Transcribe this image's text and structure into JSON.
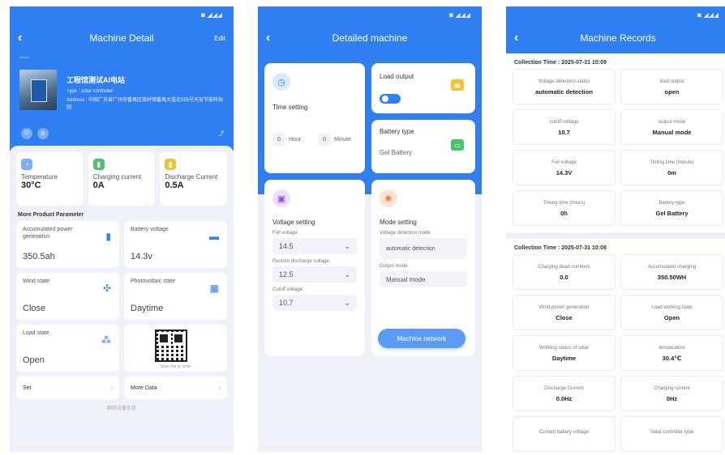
{
  "status_icons": "◾ ◢◢◢",
  "detail": {
    "nav": {
      "back": "‹",
      "title": "Machine Detail",
      "action": "Edit"
    },
    "badge": "",
    "number_label": "",
    "name": "工程馆测试AI电站",
    "type_line": "Type : solar controller",
    "address_line": "Address : 中国广东省广州市番禺区南村镇番禺大道北555号天安节能科技园",
    "share_icon": "share-icon",
    "stats": [
      {
        "label": "Temperature",
        "value": "30°C",
        "icon": "thermometer-icon",
        "color": "#7fb0f5",
        "glyph": "🌡"
      },
      {
        "label": "Charging current",
        "value": "0A",
        "icon": "battery-charge-icon",
        "color": "#4cc26a",
        "glyph": "▮"
      },
      {
        "label": "Discharge Current",
        "value": "0.5A",
        "icon": "battery-discharge-icon",
        "color": "#f5c02f",
        "glyph": "▮"
      }
    ],
    "section_title": "More Product Parameter",
    "params": [
      {
        "label": "Accumulated power generation",
        "value": "350.5ah",
        "icon": "battery-icon",
        "glyph": "▮"
      },
      {
        "label": "Battery voltage",
        "value": "14.3v",
        "icon": "voltage-icon",
        "glyph": "▬"
      },
      {
        "label": "Wind state",
        "value": "Close",
        "icon": "wind-icon",
        "glyph": "✣"
      },
      {
        "label": "Photovoltaic state",
        "value": "Daytime",
        "icon": "solar-panel-icon",
        "glyph": "▦"
      },
      {
        "label": "Load state",
        "value": "Open",
        "icon": "load-icon",
        "glyph": "⁂"
      }
    ],
    "qr_caption": "Scan the qr code",
    "selects": [
      {
        "value": "Set"
      },
      {
        "value": "More Data"
      }
    ],
    "footer": "解绑设备信息"
  },
  "machine": {
    "nav": {
      "back": "‹",
      "title": "Detailed machine"
    },
    "time": {
      "title": "Time setting",
      "hour": "Hour",
      "minute": "Minute",
      "hour_value": "0",
      "minute_value": "0"
    },
    "load": {
      "title": "Load output",
      "on": true
    },
    "battery": {
      "title": "Battery type",
      "value": "Gel Battery"
    },
    "voltage": {
      "title": "Voltage setting",
      "fields": [
        {
          "label": "Full voltage",
          "value": "14.5"
        },
        {
          "label": "Restore discharge voltage",
          "value": "12.5"
        },
        {
          "label": "Cutoff voltage",
          "value": "10.7"
        }
      ]
    },
    "mode": {
      "title": "Mode setting",
      "detect_label": "Voltage detection mode",
      "detect_value": "automatic detection",
      "output_label": "Output mode",
      "output_value": "Manual mode"
    },
    "button": "Machine network"
  },
  "records": {
    "nav": {
      "back": "‹",
      "title": "Machine Records"
    },
    "groups": [
      {
        "time": "Collection Time : 2025-07-31 10:09",
        "items": [
          {
            "label": "Voltage detection status",
            "value": "automatic detection"
          },
          {
            "label": "load output",
            "value": "open"
          },
          {
            "label": "cutoff voltage",
            "value": "10.7"
          },
          {
            "label": "output mode",
            "value": "Manual mode"
          },
          {
            "label": "Full voltage",
            "value": "14.3V"
          },
          {
            "label": "Timing time (minute)",
            "value": "0m"
          },
          {
            "label": "Timing time (hours)",
            "value": "0h"
          },
          {
            "label": "Battery type",
            "value": "Gel Battery"
          }
        ]
      },
      {
        "time": "Collection Time : 2025-07-31 10:08",
        "items": [
          {
            "label": "Charging dead numbers",
            "value": "0.0"
          },
          {
            "label": "Accumulated charging",
            "value": "350.50WH"
          },
          {
            "label": "Wind power generation",
            "value": "Close"
          },
          {
            "label": "Load working state",
            "value": "Open"
          },
          {
            "label": "Working status of solar",
            "value": "Daytime"
          },
          {
            "label": "temperature",
            "value": "30.4℃"
          },
          {
            "label": "Discharge Current",
            "value": "0.0Hz"
          },
          {
            "label": "Charging current",
            "value": "0Hz"
          },
          {
            "label": "Current battery voltage",
            "value": ""
          },
          {
            "label": "Solar controller type",
            "value": ""
          }
        ]
      }
    ]
  }
}
